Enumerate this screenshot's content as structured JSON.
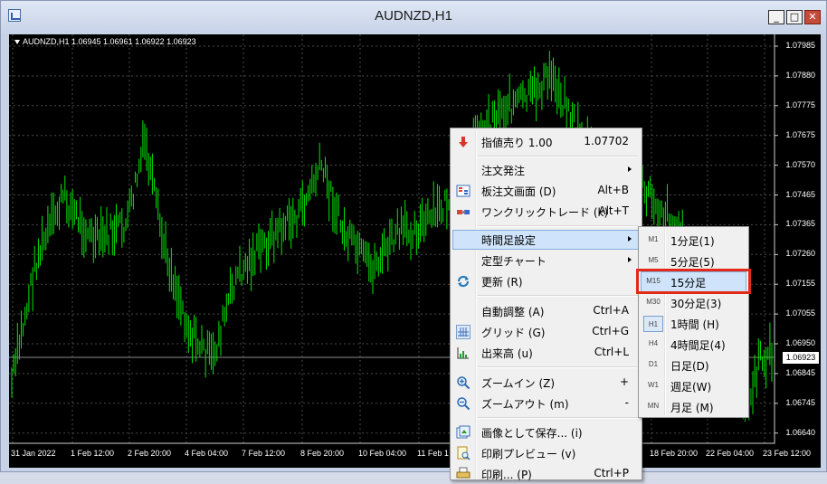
{
  "window": {
    "title": "AUDNZD,H1",
    "buttons": {
      "minimize": "_",
      "maximize": "□",
      "close": "✕"
    }
  },
  "chart": {
    "header": "AUDNZD,H1  1.06945 1.06961 1.06922 1.06923",
    "current_price": "1.06923",
    "price_levels": [
      "1.07985",
      "1.07880",
      "1.07775",
      "1.07675",
      "1.07570",
      "1.07465",
      "1.07365",
      "1.07260",
      "1.07155",
      "1.07055",
      "1.06950",
      "1.06845",
      "1.06745",
      "1.06640"
    ],
    "time_labels": [
      "31 Jan 2022",
      "1 Feb 12:00",
      "2 Feb 20:00",
      "4 Feb 04:00",
      "7 Feb 12:00",
      "8 Feb 20:00",
      "10 Feb 04:00",
      "11 Feb 1",
      "18 Feb 20:00",
      "22 Feb 04:00",
      "23 Feb 12:00"
    ],
    "bar_color": "#00e600"
  },
  "context_menu": {
    "items": [
      {
        "label": "指値売り 1.00",
        "shortcut": "1.07702",
        "icon": "sell-arrow-icon"
      },
      {
        "label": "注文発注",
        "submenu": true
      },
      {
        "label": "板注文画面 (D)",
        "shortcut": "Alt+B",
        "icon": "depth-of-market-icon"
      },
      {
        "label": "ワンクリックトレード (k)",
        "shortcut": "Alt+T",
        "icon": "one-click-trading-icon"
      },
      {
        "label": "時間足設定",
        "submenu": true
      },
      {
        "label": "定型チャート",
        "submenu": true
      },
      {
        "label": "更新 (R)",
        "icon": "refresh-icon"
      },
      {
        "label": "自動調整 (A)",
        "shortcut": "Ctrl+A"
      },
      {
        "label": "グリッド (G)",
        "shortcut": "Ctrl+G",
        "icon": "grid-icon"
      },
      {
        "label": "出来高 (u)",
        "shortcut": "Ctrl+L",
        "icon": "volumes-icon"
      },
      {
        "label": "ズームイン (Z)",
        "shortcut": "+",
        "icon": "zoom-in-icon"
      },
      {
        "label": "ズームアウト (m)",
        "shortcut": "-",
        "icon": "zoom-out-icon"
      },
      {
        "label": "画像として保存... (i)",
        "icon": "save-picture-icon"
      },
      {
        "label": "印刷プレビュー (v)",
        "icon": "print-preview-icon"
      },
      {
        "label": "印刷... (P)",
        "shortcut": "Ctrl+P",
        "icon": "print-icon"
      }
    ]
  },
  "timeframe_submenu": {
    "items": [
      {
        "code": "M1",
        "label": "1分足(1)"
      },
      {
        "code": "M5",
        "label": "5分足(5)"
      },
      {
        "code": "M15",
        "label": "15分足"
      },
      {
        "code": "M30",
        "label": "30分足(3)"
      },
      {
        "code": "H1",
        "label": "1時間 (H)",
        "active": true
      },
      {
        "code": "H4",
        "label": "4時間足(4)"
      },
      {
        "code": "D1",
        "label": "日足(D)"
      },
      {
        "code": "W1",
        "label": "週足(W)"
      },
      {
        "code": "MN",
        "label": "月足 (M)"
      }
    ],
    "highlighted": "M15",
    "highlight_color": "#e12a18"
  }
}
